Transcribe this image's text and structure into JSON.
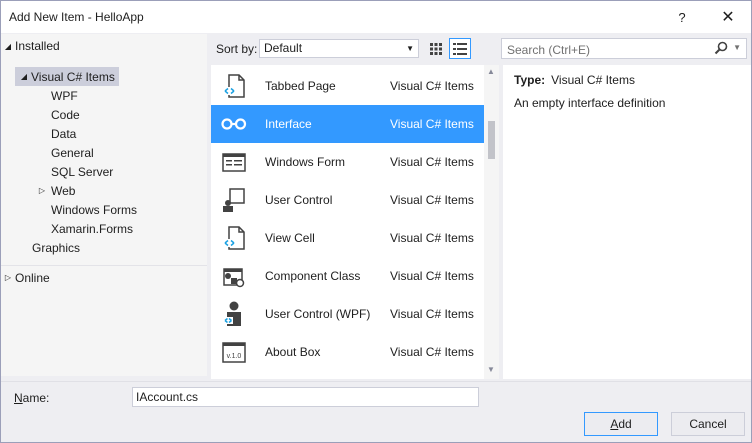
{
  "window": {
    "title": "Add New Item - HelloApp",
    "help_glyph": "?",
    "close_glyph": "✕"
  },
  "tree": {
    "installed_label": "Installed",
    "root_label": "Visual C# Items",
    "children": [
      "WPF",
      "Code",
      "Data",
      "General",
      "SQL Server",
      "Web",
      "Windows Forms",
      "Xamarin.Forms"
    ],
    "graphics_label": "Graphics",
    "online_label": "Online"
  },
  "sort": {
    "label": "Sort by:",
    "value": "Default"
  },
  "search": {
    "placeholder": "Search (Ctrl+E)"
  },
  "items": [
    {
      "name": "Tabbed Page",
      "category": "Visual C# Items",
      "icon": "xaml-page-icon"
    },
    {
      "name": "Interface",
      "category": "Visual C# Items",
      "icon": "interface-icon"
    },
    {
      "name": "Windows Form",
      "category": "Visual C# Items",
      "icon": "windows-form-icon"
    },
    {
      "name": "User Control",
      "category": "Visual C# Items",
      "icon": "user-control-icon"
    },
    {
      "name": "View Cell",
      "category": "Visual C# Items",
      "icon": "xaml-page-icon"
    },
    {
      "name": "Component Class",
      "category": "Visual C# Items",
      "icon": "component-class-icon"
    },
    {
      "name": "User Control (WPF)",
      "category": "Visual C# Items",
      "icon": "user-control-wpf-icon"
    },
    {
      "name": "About Box",
      "category": "Visual C# Items",
      "icon": "about-box-icon"
    }
  ],
  "about_box_icon_text": "v.1.0",
  "details": {
    "type_label": "Type:",
    "type_value": "Visual C# Items",
    "description": "An empty interface definition"
  },
  "name_field": {
    "label_first": "N",
    "label_rest": "ame:",
    "value": "IAccount.cs"
  },
  "buttons": {
    "add_first": "A",
    "add_rest": "dd",
    "cancel": "Cancel"
  },
  "colors": {
    "selection": "#3399ff",
    "tree_selection": "#cccedb",
    "dialog_bg": "#eeeef2"
  }
}
